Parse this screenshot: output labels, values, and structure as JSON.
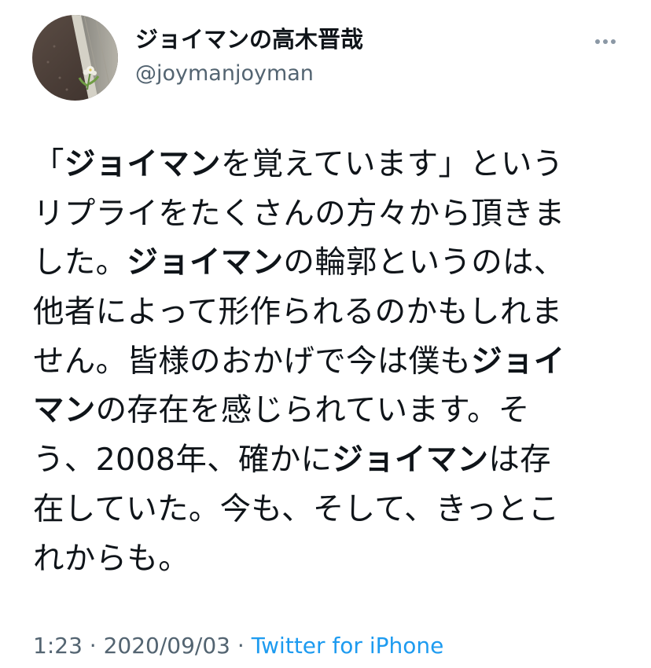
{
  "author": {
    "display_name": "ジョイマンの高木晋哉",
    "handle": "@joymanjoyman",
    "avatar_icon": "avatar-photo-flower-by-wall"
  },
  "actions": {
    "more_icon": "more-horizontal-icon"
  },
  "tweet": {
    "lines": [
      [
        {
          "t": "「",
          "b": false
        },
        {
          "t": "ジョイマン",
          "b": true
        },
        {
          "t": "を覚えています」という",
          "b": false
        }
      ],
      [
        {
          "t": "リプライをたくさんの方々から頂きま",
          "b": false
        }
      ],
      [
        {
          "t": "した。",
          "b": false
        },
        {
          "t": "ジョイマン",
          "b": true
        },
        {
          "t": "の輪郭というのは、",
          "b": false
        }
      ],
      [
        {
          "t": "他者によって形作られるのかもしれま",
          "b": false
        }
      ],
      [
        {
          "t": "せん。皆様のおかげで今は僕も",
          "b": false
        },
        {
          "t": "ジョイ",
          "b": true
        }
      ],
      [
        {
          "t": "マン",
          "b": true
        },
        {
          "t": "の存在を感じられています。そ",
          "b": false
        }
      ],
      [
        {
          "t": "う、2008年、確かに",
          "b": false
        },
        {
          "t": "ジョイマン",
          "b": true
        },
        {
          "t": "は存",
          "b": false
        }
      ],
      [
        {
          "t": "在していた。今も、そして、きっとこ",
          "b": false
        }
      ],
      [
        {
          "t": "れからも。",
          "b": false
        }
      ]
    ]
  },
  "meta": {
    "time": "1:23",
    "separator": " · ",
    "date": "2020/09/03",
    "source": "Twitter for iPhone"
  },
  "colors": {
    "text": "#0f1419",
    "secondary": "#536471",
    "link": "#1d9bf0",
    "more_dots": "#8b98a5"
  }
}
